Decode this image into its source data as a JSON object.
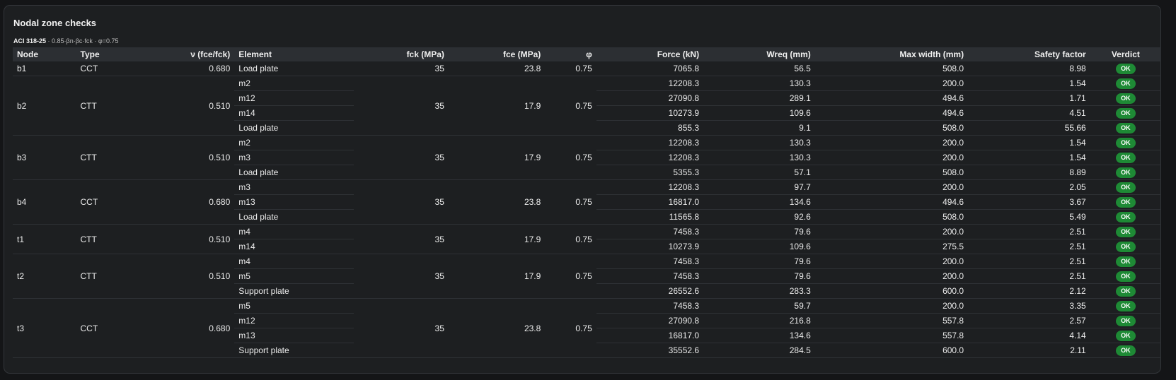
{
  "panel": {
    "title": "Nodal zone checks",
    "code": "ACI 318-25",
    "formula": " · 0.85·βn·βc·fck · φ=0.75"
  },
  "columns": [
    "Node",
    "Type",
    "ν (fce/fck)",
    "Element",
    "fck (MPa)",
    "fce (MPa)",
    "φ",
    "Force (kN)",
    "Wreq (mm)",
    "Max width (mm)",
    "Safety factor",
    "Verdict"
  ],
  "nodes": [
    {
      "node": "b1",
      "type": "CCT",
      "nu": "0.680",
      "fck": "35",
      "fce": "23.8",
      "phi": "0.75",
      "elements": [
        {
          "element": "Load plate",
          "force": "7065.8",
          "wreq": "56.5",
          "maxw": "508.0",
          "sf": "8.98",
          "verdict": "OK"
        }
      ]
    },
    {
      "node": "b2",
      "type": "CTT",
      "nu": "0.510",
      "fck": "35",
      "fce": "17.9",
      "phi": "0.75",
      "elements": [
        {
          "element": "m2",
          "force": "12208.3",
          "wreq": "130.3",
          "maxw": "200.0",
          "sf": "1.54",
          "verdict": "OK"
        },
        {
          "element": "m12",
          "force": "27090.8",
          "wreq": "289.1",
          "maxw": "494.6",
          "sf": "1.71",
          "verdict": "OK"
        },
        {
          "element": "m14",
          "force": "10273.9",
          "wreq": "109.6",
          "maxw": "494.6",
          "sf": "4.51",
          "verdict": "OK"
        },
        {
          "element": "Load plate",
          "force": "855.3",
          "wreq": "9.1",
          "maxw": "508.0",
          "sf": "55.66",
          "verdict": "OK"
        }
      ]
    },
    {
      "node": "b3",
      "type": "CTT",
      "nu": "0.510",
      "fck": "35",
      "fce": "17.9",
      "phi": "0.75",
      "elements": [
        {
          "element": "m2",
          "force": "12208.3",
          "wreq": "130.3",
          "maxw": "200.0",
          "sf": "1.54",
          "verdict": "OK"
        },
        {
          "element": "m3",
          "force": "12208.3",
          "wreq": "130.3",
          "maxw": "200.0",
          "sf": "1.54",
          "verdict": "OK"
        },
        {
          "element": "Load plate",
          "force": "5355.3",
          "wreq": "57.1",
          "maxw": "508.0",
          "sf": "8.89",
          "verdict": "OK"
        }
      ]
    },
    {
      "node": "b4",
      "type": "CCT",
      "nu": "0.680",
      "fck": "35",
      "fce": "23.8",
      "phi": "0.75",
      "elements": [
        {
          "element": "m3",
          "force": "12208.3",
          "wreq": "97.7",
          "maxw": "200.0",
          "sf": "2.05",
          "verdict": "OK"
        },
        {
          "element": "m13",
          "force": "16817.0",
          "wreq": "134.6",
          "maxw": "494.6",
          "sf": "3.67",
          "verdict": "OK"
        },
        {
          "element": "Load plate",
          "force": "11565.8",
          "wreq": "92.6",
          "maxw": "508.0",
          "sf": "5.49",
          "verdict": "OK"
        }
      ]
    },
    {
      "node": "t1",
      "type": "CTT",
      "nu": "0.510",
      "fck": "35",
      "fce": "17.9",
      "phi": "0.75",
      "elements": [
        {
          "element": "m4",
          "force": "7458.3",
          "wreq": "79.6",
          "maxw": "200.0",
          "sf": "2.51",
          "verdict": "OK"
        },
        {
          "element": "m14",
          "force": "10273.9",
          "wreq": "109.6",
          "maxw": "275.5",
          "sf": "2.51",
          "verdict": "OK"
        }
      ]
    },
    {
      "node": "t2",
      "type": "CTT",
      "nu": "0.510",
      "fck": "35",
      "fce": "17.9",
      "phi": "0.75",
      "elements": [
        {
          "element": "m4",
          "force": "7458.3",
          "wreq": "79.6",
          "maxw": "200.0",
          "sf": "2.51",
          "verdict": "OK"
        },
        {
          "element": "m5",
          "force": "7458.3",
          "wreq": "79.6",
          "maxw": "200.0",
          "sf": "2.51",
          "verdict": "OK"
        },
        {
          "element": "Support plate",
          "force": "26552.6",
          "wreq": "283.3",
          "maxw": "600.0",
          "sf": "2.12",
          "verdict": "OK"
        }
      ]
    },
    {
      "node": "t3",
      "type": "CCT",
      "nu": "0.680",
      "fck": "35",
      "fce": "23.8",
      "phi": "0.75",
      "elements": [
        {
          "element": "m5",
          "force": "7458.3",
          "wreq": "59.7",
          "maxw": "200.0",
          "sf": "3.35",
          "verdict": "OK"
        },
        {
          "element": "m12",
          "force": "27090.8",
          "wreq": "216.8",
          "maxw": "557.8",
          "sf": "2.57",
          "verdict": "OK"
        },
        {
          "element": "m13",
          "force": "16817.0",
          "wreq": "134.6",
          "maxw": "557.8",
          "sf": "4.14",
          "verdict": "OK"
        },
        {
          "element": "Support plate",
          "force": "35552.6",
          "wreq": "284.5",
          "maxw": "600.0",
          "sf": "2.11",
          "verdict": "OK"
        }
      ]
    }
  ],
  "colors": {
    "background": "#141517",
    "panel": "#1d1f21",
    "header_row": "#2c2f33",
    "ok_badge": "#1e8a35"
  }
}
